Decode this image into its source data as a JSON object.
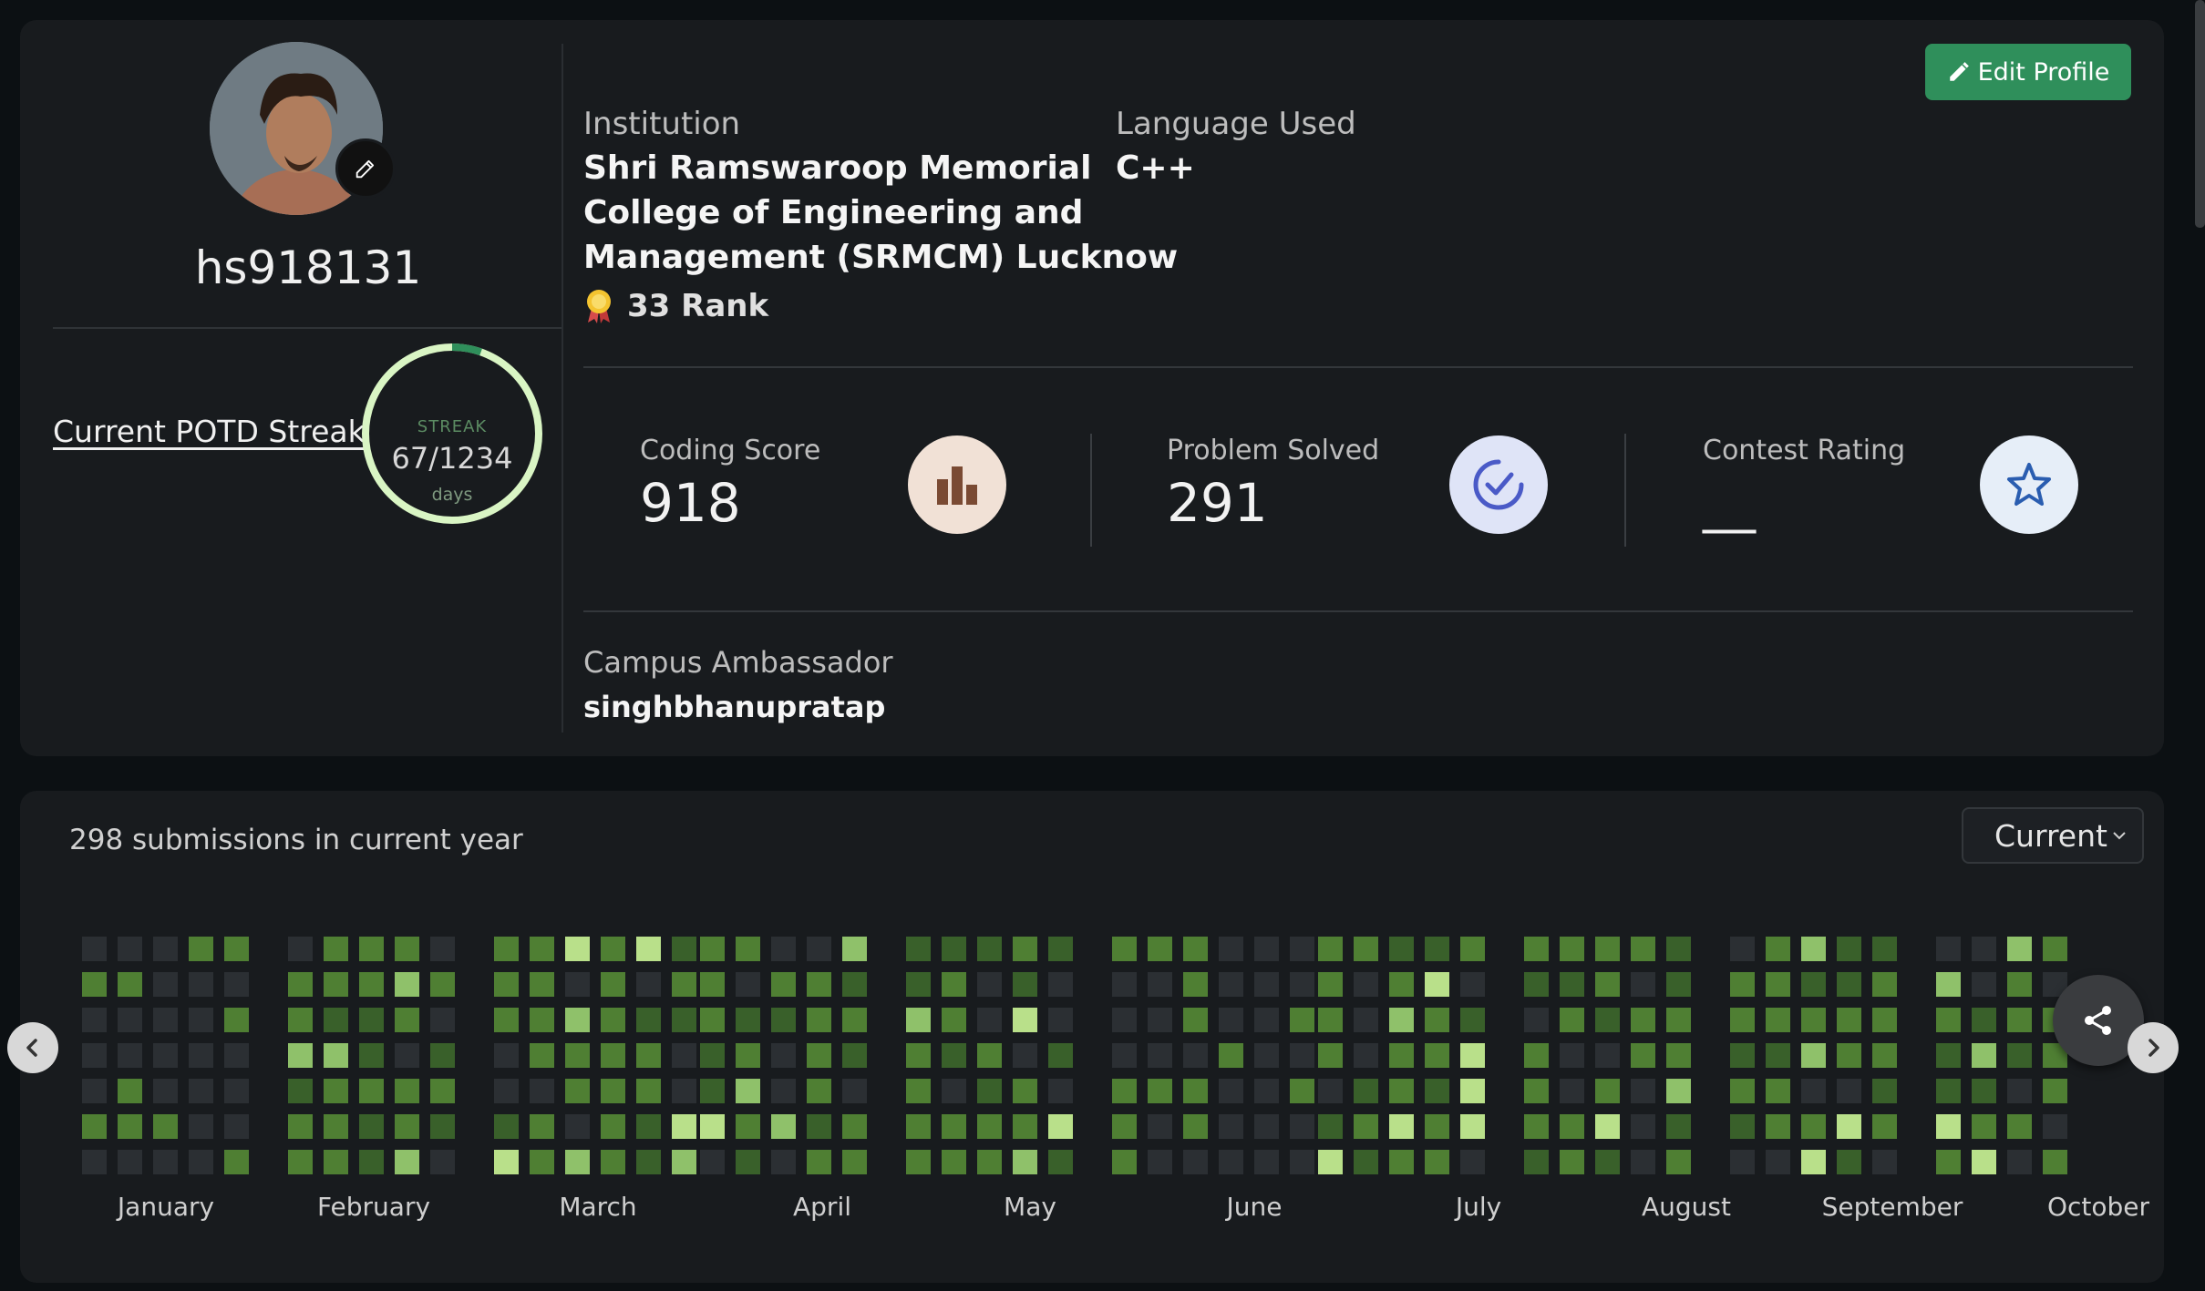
{
  "profile": {
    "username": "hs918131",
    "streak_label": "Current POTD Streak",
    "streak_caption": "STREAK",
    "streak_value": "67/1234",
    "streak_unit": "days",
    "streak_fraction": 0.054,
    "edit_button": "Edit Profile",
    "institution_label": "Institution",
    "institution_lines": [
      "Shri Ramswaroop Memorial",
      "College of Engineering and",
      "Management (SRMCM) Lucknow"
    ],
    "language_label": "Language Used",
    "language_value": "C++",
    "rank": "33 Rank",
    "stats": [
      {
        "label": "Coding Score",
        "value": "918"
      },
      {
        "label": "Problem Solved",
        "value": "291"
      },
      {
        "label": "Contest Rating",
        "value": "__"
      }
    ],
    "ambassador_label": "Campus Ambassador",
    "ambassador_value": "singhbhanupratap"
  },
  "activity": {
    "submissions_text": "298 submissions in current year",
    "year_select": "Current",
    "months": [
      "January",
      "February",
      "March",
      "April",
      "May",
      "June",
      "July",
      "August",
      "September",
      "October"
    ],
    "colors": {
      "empty": "#2b2f33",
      "l1": "#39602a",
      "l2": "#4f7f33",
      "l3": "#8fc16a",
      "l4": "#b9e08a",
      "mid": "#6d7f45"
    }
  }
}
